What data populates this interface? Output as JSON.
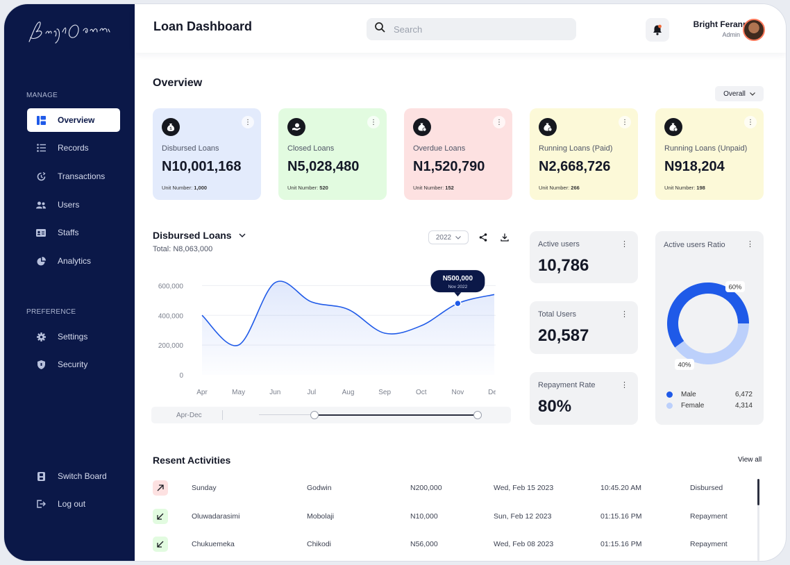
{
  "sidebar": {
    "manage_label": "MANAGE",
    "preference_label": "PREFERENCE",
    "items": [
      {
        "label": "Overview",
        "icon": "overview-icon"
      },
      {
        "label": "Records",
        "icon": "list-icon"
      },
      {
        "label": "Transactions",
        "icon": "transactions-icon"
      },
      {
        "label": "Users",
        "icon": "users-icon"
      },
      {
        "label": "Staffs",
        "icon": "id-card-icon"
      },
      {
        "label": "Analytics",
        "icon": "pie-icon"
      }
    ],
    "pref_items": [
      {
        "label": "Settings",
        "icon": "gear-icon"
      },
      {
        "label": "Security",
        "icon": "shield-icon"
      }
    ],
    "bottom_items": [
      {
        "label": "Switch Board",
        "icon": "switch-icon"
      },
      {
        "label": "Log out",
        "icon": "logout-icon"
      }
    ]
  },
  "header": {
    "title": "Loan Dashboard",
    "search_placeholder": "Search",
    "user_name": "Bright Feranmi",
    "user_role": "Admin"
  },
  "overview": {
    "title": "Overview",
    "filter": "Overall",
    "cards": [
      {
        "label": "Disbursed Loans",
        "value": "N10,001,168",
        "unit_label": "Unit Number:",
        "unit_value": "1,000",
        "color": "#e3ebfc"
      },
      {
        "label": "Closed Loans",
        "value": "N5,028,480",
        "unit_label": "Unit Number:",
        "unit_value": "520",
        "color": "#e2fbe0"
      },
      {
        "label": "Overdue Loans",
        "value": "N1,520,790",
        "unit_label": "Unit Number:",
        "unit_value": "152",
        "color": "#fde1e1"
      },
      {
        "label": "Running Loans (Paid)",
        "value": "N2,668,726",
        "unit_label": "Unit Number:",
        "unit_value": "266",
        "color": "#fcf9d8"
      },
      {
        "label": "Running Loans (Unpaid)",
        "value": "N918,204",
        "unit_label": "Unit Number:",
        "unit_value": "198",
        "color": "#fcf9d8"
      }
    ]
  },
  "chart_section": {
    "title": "Disbursed Loans",
    "total": "Total: N8,063,000",
    "year": "2022",
    "range_label": "Apr-Dec"
  },
  "chart_data": {
    "type": "line",
    "categories": [
      "Apr",
      "May",
      "Jun",
      "Jul",
      "Aug",
      "Sep",
      "Oct",
      "Nov",
      "Dec"
    ],
    "series": [
      {
        "values": [
          400000,
          200000,
          620000,
          490000,
          440000,
          280000,
          330000,
          480000,
          540000
        ]
      }
    ],
    "yticks": [
      "0",
      "200,000",
      "400,000",
      "600,000"
    ],
    "ylim": [
      0,
      700000
    ],
    "tooltip": {
      "value": "N500,000",
      "date": "Nov 2022",
      "index": 7
    },
    "line_color": "#1f5ae8"
  },
  "stats": [
    {
      "label": "Active users",
      "value": "10,786"
    },
    {
      "label": "Total Users",
      "value": "20,587"
    },
    {
      "label": "Repayment Rate",
      "value": "80%"
    }
  ],
  "ratio": {
    "title": "Active users Ratio",
    "male_pct_label": "60%",
    "female_pct_label": "40%",
    "male_fraction": 0.6,
    "legend": [
      {
        "label": "Male",
        "value": "6,472",
        "color": "#1f5ae8"
      },
      {
        "label": "Female",
        "value": "4,314",
        "color": "#bcd0fb"
      }
    ]
  },
  "activities": {
    "title": "Resent Activities",
    "view_all": "View all",
    "rows": [
      {
        "name": "Sunday",
        "by": "Godwin",
        "amount": "N200,000",
        "date": "Wed, Feb 15 2023",
        "time": "10:45.20 AM",
        "type": "Disbursed",
        "direction": "up"
      },
      {
        "name": "Oluwadarasimi",
        "by": "Mobolaji",
        "amount": "N10,000",
        "date": "Sun, Feb 12 2023",
        "time": "01:15.16 PM",
        "type": "Repayment",
        "direction": "down"
      },
      {
        "name": "Chukuemeka",
        "by": "Chikodi",
        "amount": "N56,000",
        "date": "Wed, Feb 08 2023",
        "time": "01:15.16 PM",
        "type": "Repayment",
        "direction": "down"
      }
    ]
  }
}
